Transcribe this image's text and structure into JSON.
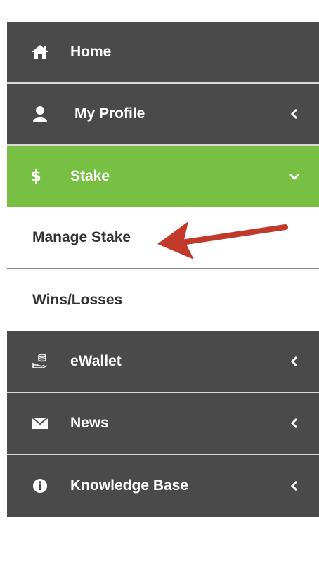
{
  "menu": {
    "items": [
      {
        "label": "Home",
        "icon": "home-icon",
        "chevron": "none"
      },
      {
        "label": "My Profile",
        "icon": "user-icon",
        "chevron": "left"
      },
      {
        "label": "Stake",
        "icon": "dollar-icon",
        "chevron": "down",
        "active": true
      },
      {
        "label": "Manage Stake",
        "type": "submenu"
      },
      {
        "label": "Wins/Losses",
        "type": "submenu"
      },
      {
        "label": "eWallet",
        "icon": "wallet-coins-icon",
        "chevron": "left"
      },
      {
        "label": "News",
        "icon": "envelope-icon",
        "chevron": "left"
      },
      {
        "label": "Knowledge Base",
        "icon": "info-circle-icon",
        "chevron": "left"
      }
    ]
  },
  "colors": {
    "dark_bg": "#4a4a4a",
    "active_bg": "#78c043",
    "submenu_text": "#333333",
    "annotation_arrow": "#c0392b"
  },
  "annotation": {
    "icon": "red-arrow-icon"
  }
}
